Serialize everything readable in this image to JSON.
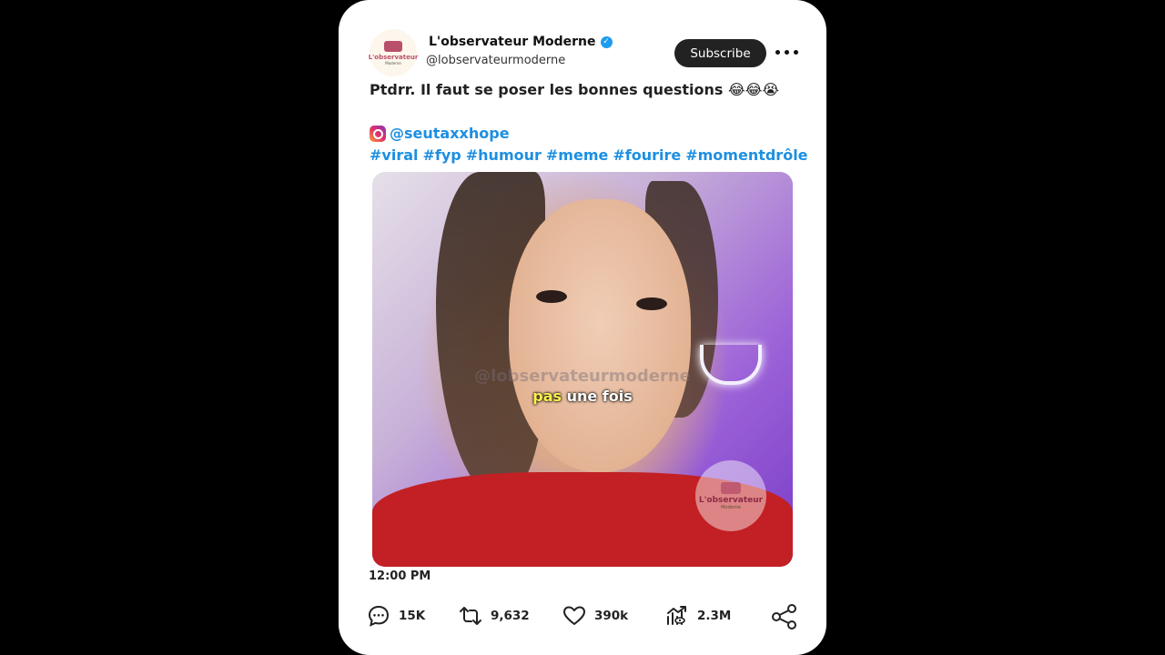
{
  "post": {
    "author_name": "L'observateur Moderne",
    "handle": "@lobservateurmoderne",
    "avatar_text_1": "L'observateur",
    "avatar_text_2": "Moderne",
    "subscribe_label": "Subscribe",
    "caption": "Ptdrr. Il faut se poser les bonnes questions 😂😂😭",
    "source_handle": "@seutaxxhope",
    "hashtags": [
      "#viral",
      "#fyp",
      "#humour",
      "#meme",
      "#fourire",
      "#momentdrôle"
    ],
    "video": {
      "watermark": "@lobservateurmoderne",
      "subtitle_highlight": "pas",
      "subtitle_rest": " une fois",
      "badge_text_1": "L'observateur",
      "badge_text_2": "Moderne"
    },
    "time": "12:00 PM",
    "stats": {
      "replies": "15K",
      "reposts": "9,632",
      "likes": "390k",
      "views": "2.3M"
    }
  },
  "colors": {
    "background": "#000000",
    "card": "#ffffff",
    "link": "#1d8fe1",
    "subscribe_button": "#222222",
    "verified": "#1d9bf0"
  },
  "icons": [
    "verified-icon",
    "more-icon",
    "instagram-icon",
    "reply-icon",
    "repost-icon",
    "like-icon",
    "views-icon",
    "share-icon"
  ]
}
